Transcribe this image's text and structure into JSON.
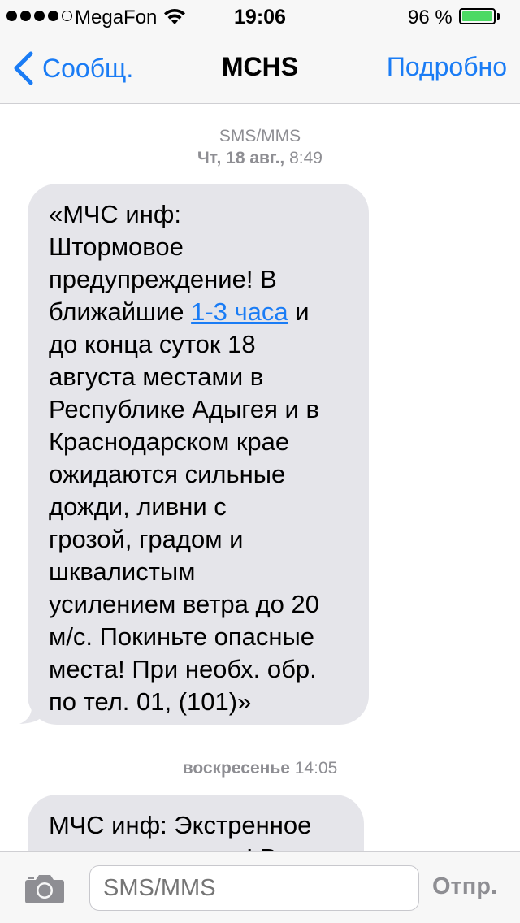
{
  "status_bar": {
    "carrier": "MegaFon",
    "time": "19:06",
    "battery_percent": "96 %",
    "battery_level": 0.96,
    "signal_bars": 4,
    "signal_max": 5
  },
  "nav": {
    "back_label": "Сообщ.",
    "title": "MCHS",
    "details_label": "Подробно"
  },
  "thread": {
    "header_type": "SMS/MMS",
    "first_stamp_day": "Чт, 18 авг.,",
    "first_stamp_time": " 8:49",
    "message1": {
      "before_link": "«МЧС инф:\nШтормовое\nпредупреждение! В\nближайшие ",
      "link": "1-3 часа",
      "after_link": " и\nдо конца суток 18\nавгуста местами в\nРеспублике Адыгея и в\nКраснодарском крае\nожидаются сильные\nдожди, ливни с\nгрозой, градом и\nшквалистым\nусилением ветра до 20\nм/с. Покиньте опасные\nместа! При необх. обр.\nпо тел. 01, (101)»"
    },
    "second_stamp_day": "воскресенье",
    "second_stamp_time": " 14:05",
    "message2": "МЧС инф: Экстренное\nпредупреждение! В"
  },
  "input": {
    "placeholder": "SMS/MMS",
    "send_label": "Отпр."
  },
  "colors": {
    "accent": "#1a7cf5",
    "bubble": "#e5e5ea",
    "battery": "#4cd964",
    "muted": "#8e8e93"
  },
  "icons": [
    "signal-dots-icon",
    "wifi-icon",
    "battery-icon",
    "back-chevron-icon",
    "camera-icon"
  ]
}
